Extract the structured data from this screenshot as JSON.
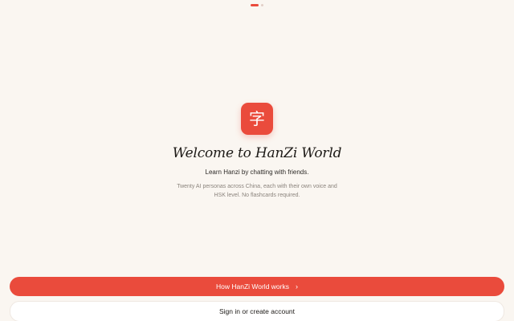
{
  "pager": {
    "total": 2,
    "active_index": 0
  },
  "logo": {
    "glyph": "字",
    "icon": "hanzi-logo-icon"
  },
  "hero": {
    "title": "Welcome to HanZi World",
    "subtitle": "Learn Hanzi by chatting with friends.",
    "description": "Twenty AI personas across China, each with their own voice and HSK level. No flashcards required."
  },
  "actions": {
    "primary_label": "How HanZi World works",
    "primary_icon": "chevron-right-icon",
    "secondary_label": "Sign in or create account"
  },
  "colors": {
    "accent": "#ea4b3c",
    "background": "#faf6f1",
    "text": "#1d1a17",
    "muted": "#8b847d"
  }
}
